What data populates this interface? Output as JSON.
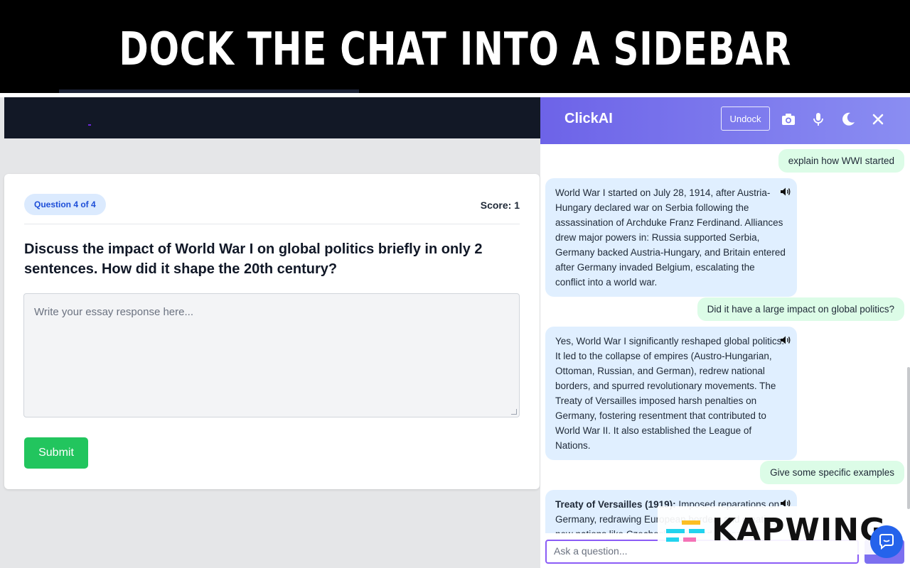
{
  "banner": {
    "title": "DOCK THE CHAT INTO A SIDEBAR"
  },
  "quiz": {
    "progress_badge": "Question 4 of 4",
    "score": "Score: 1",
    "question": "Discuss the impact of World War I on global politics briefly in only 2 sentences. How did it shape the 20th century?",
    "essay_placeholder": "Write your essay response here...",
    "submit_label": "Submit",
    "colors": {
      "submit": "#22c55e",
      "badge_bg": "#dbeafe",
      "badge_text": "#1d4ed8"
    }
  },
  "chat": {
    "brand": "ClickAI",
    "undock_label": "Undock",
    "header_icons": [
      "camera-icon",
      "microphone-icon",
      "moon-icon",
      "close-icon"
    ],
    "messages": [
      {
        "role": "user",
        "text": "explain how WWI started"
      },
      {
        "role": "assistant",
        "text": "World War I started on July 28, 1914, after Austria-Hungary declared war on Serbia following the assassination of Archduke Franz Ferdinand. Alliances drew major powers in: Russia supported Serbia, Germany backed Austria-Hungary, and Britain entered after Germany invaded Belgium, escalating the conflict into a world war."
      },
      {
        "role": "user",
        "text": "Did it have a large impact on global politics?"
      },
      {
        "role": "assistant",
        "text": "Yes, World War I significantly reshaped global politics. It led to the collapse of empires (Austro-Hungarian, Ottoman, Russian, and German), redrew national borders, and spurred revolutionary movements. The Treaty of Versailles imposed harsh penalties on Germany, fostering resentment that contributed to World War II. It also established the League of Nations."
      },
      {
        "role": "user",
        "text": "Give some specific examples"
      },
      {
        "role": "assistant",
        "bold": "Treaty of Versailles (1919):",
        "text": " Imposed reparations on Germany, redrawing European borders and creating new nations like Czechoslovakia and Yugoslavia."
      }
    ],
    "input_placeholder": "Ask a question...",
    "colors": {
      "user_bubble": "#dcfce7",
      "bot_bubble": "#e0efff",
      "header_start": "#6d63e8",
      "header_end": "#8a8df2"
    }
  },
  "watermark": {
    "text": "KAPWING"
  }
}
